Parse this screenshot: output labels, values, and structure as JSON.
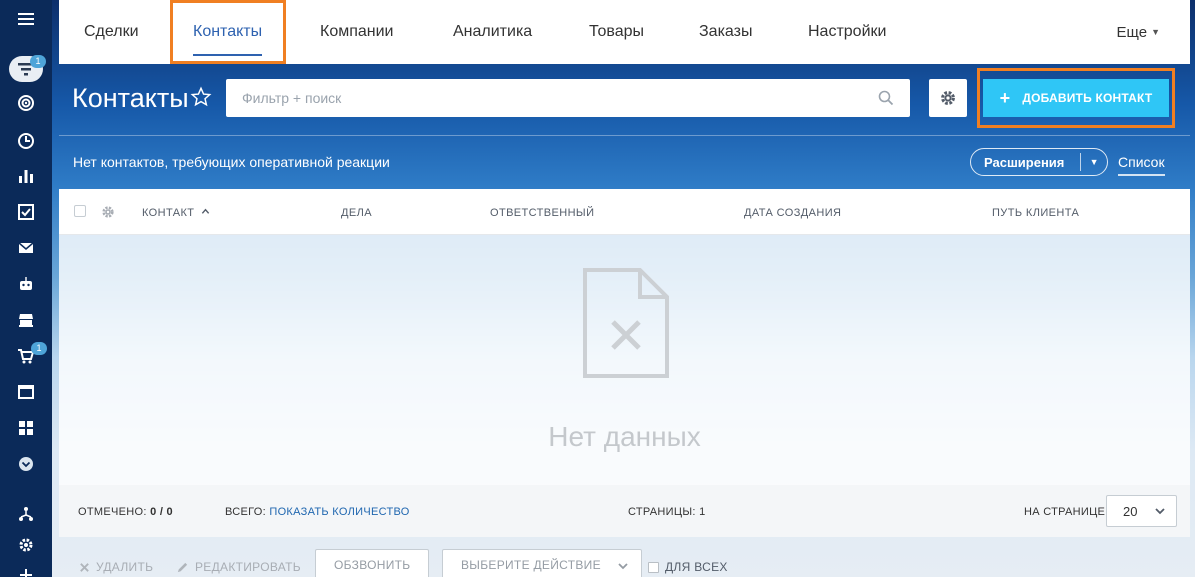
{
  "rail": {
    "badge_top": "1",
    "badge_cart": "1"
  },
  "nav": {
    "tabs": [
      "Сделки",
      "Контакты",
      "Компании",
      "Аналитика",
      "Товары",
      "Заказы",
      "Настройки"
    ],
    "more": "Еще"
  },
  "page": {
    "title": "Контакты",
    "filter_placeholder": "Фильтр + поиск",
    "add_button": "ДОБАВИТЬ КОНТАКТ",
    "notice": "Нет контактов, требующих оперативной реакции",
    "extensions": "Расширения",
    "list_view": "Список"
  },
  "grid": {
    "columns": [
      "КОНТАКТ",
      "ДЕЛА",
      "ОТВЕТСТВЕННЫЙ",
      "ДАТА СОЗДАНИЯ",
      "ПУТЬ КЛИЕНТА"
    ],
    "sort_indicator": "^",
    "empty_text": "Нет данных"
  },
  "footer": {
    "selected_label": "ОТМЕЧЕНО:",
    "selected_value": "0 / 0",
    "total_label": "ВСЕГО:",
    "total_link": "ПОКАЗАТЬ КОЛИЧЕСТВО",
    "pages_label": "СТРАНИЦЫ:",
    "pages_value": "1",
    "per_page_label": "НА СТРАНИЦЕ:",
    "per_page_value": "20"
  },
  "actions": {
    "delete": "УДАЛИТЬ",
    "edit": "РЕДАКТИРОВАТЬ",
    "call": "ОБЗВОНИТЬ",
    "choose_action": "ВЫБЕРИТЕ ДЕЙСТВИЕ",
    "for_all": "ДЛЯ ВСЕХ"
  },
  "colors": {
    "accent": "#2fc6f6",
    "highlight": "#f07f22",
    "link": "#2067b0"
  }
}
